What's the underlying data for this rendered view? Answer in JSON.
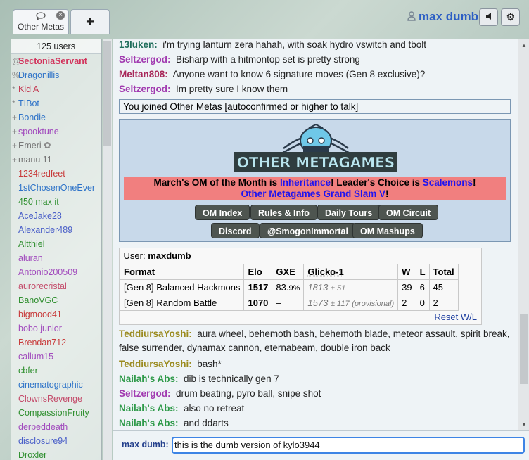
{
  "header": {
    "tab_label": "Other Metas",
    "tab_icon": "speech-bubble-icon",
    "new_tab": "+",
    "username": "max dumb"
  },
  "userlist": {
    "count": "125 users",
    "items": [
      {
        "rank": "@",
        "name": "SectoniaServant",
        "color": "#d2345c",
        "bold": true
      },
      {
        "rank": "%",
        "name": "Dragonillis",
        "color": "#2e73c8"
      },
      {
        "rank": "*",
        "name": "Kid A",
        "color": "#c4364f"
      },
      {
        "rank": "*",
        "name": "TIBot",
        "color": "#2e73c8"
      },
      {
        "rank": "+",
        "name": "Bondie",
        "color": "#2e73c8"
      },
      {
        "rank": "+",
        "name": "spooktune",
        "color": "#a14bbd"
      },
      {
        "rank": "+",
        "name": "Emeri",
        "color": "#777",
        "flower": true
      },
      {
        "rank": "+",
        "name": "manu 11",
        "color": "#777"
      },
      {
        "rank": "",
        "name": "1234redfeet",
        "color": "#c83b3b"
      },
      {
        "rank": "",
        "name": "1stChosenOneEver",
        "color": "#2e73c8"
      },
      {
        "rank": "",
        "name": "450 max it",
        "color": "#2f8f2f"
      },
      {
        "rank": "",
        "name": "AceJake28",
        "color": "#4a5fc8"
      },
      {
        "rank": "",
        "name": "Alexander489",
        "color": "#4a5fc8"
      },
      {
        "rank": "",
        "name": "Altthiel",
        "color": "#2f8f2f"
      },
      {
        "rank": "",
        "name": "aluran",
        "color": "#a14bbd"
      },
      {
        "rank": "",
        "name": "Antonio200509",
        "color": "#a14bbd"
      },
      {
        "rank": "",
        "name": "aurorecristal",
        "color": "#c44b6a"
      },
      {
        "rank": "",
        "name": "BanoVGC",
        "color": "#2f8f2f"
      },
      {
        "rank": "",
        "name": "bigmood41",
        "color": "#c83b3b"
      },
      {
        "rank": "",
        "name": "bobo junior",
        "color": "#a14bbd"
      },
      {
        "rank": "",
        "name": "Brendan712",
        "color": "#c83b3b"
      },
      {
        "rank": "",
        "name": "callum15",
        "color": "#a14bbd"
      },
      {
        "rank": "",
        "name": "cbfer",
        "color": "#2f8f2f"
      },
      {
        "rank": "",
        "name": "cinematographic",
        "color": "#2e73c8"
      },
      {
        "rank": "",
        "name": "ClownsRevenge",
        "color": "#c44b6a"
      },
      {
        "rank": "",
        "name": "CompassionFruity",
        "color": "#2f8f2f"
      },
      {
        "rank": "",
        "name": "derpeddeath",
        "color": "#a14bbd"
      },
      {
        "rank": "",
        "name": "disclosure94",
        "color": "#4a5fc8"
      },
      {
        "rank": "",
        "name": "Droxler",
        "color": "#2f8f2f"
      }
    ]
  },
  "chat_top": [
    {
      "user": "13luken:",
      "color": "#1f6e5c",
      "text": "i'm trying lanturn zera hahah, with soak hydro vswitch and tbolt"
    },
    {
      "user": "Seltzergod:",
      "color": "#a13ab0",
      "text": "Bisharp with a hitmontop set is pretty strong"
    },
    {
      "user": "Meltan808:",
      "color": "#a8285a",
      "text": "Anyone want to know 6 signature moves (Gen 8 exclusive)?"
    },
    {
      "user": "Seltzergod:",
      "color": "#a13ab0",
      "text": "Im pretty sure I know them"
    }
  ],
  "notice": "You joined Other Metas [autoconfirmed or higher to talk]",
  "om_box": {
    "logo_text": "OTHER METAGAMES",
    "line1_a": "March's OM of the Month is ",
    "line1_b": "Inheritance",
    "line1_c": "! Leader's Choice is ",
    "line1_d": "Scalemons",
    "line1_e": "!",
    "line2": "Other Metagames Grand Slam V",
    "line2_end": "!",
    "buttons_row1": [
      "OM Index",
      "Rules & Info",
      "Daily Tours",
      "OM Circuit"
    ],
    "buttons_row2": [
      "Discord",
      "@SmogonImmortal",
      "OM Mashups"
    ]
  },
  "stats": {
    "user_label": "User:",
    "user": "maxdumb",
    "headers": [
      "Format",
      "Elo",
      "GXE",
      "Glicko-1",
      "W",
      "L",
      "Total"
    ],
    "rows": [
      {
        "format": "[Gen 8] Balanced Hackmons",
        "elo": "1517",
        "gxe": "83.",
        "gxe_small": "9%",
        "glicko": "1813",
        "glicko_pm": "± 51",
        "glicko_note": "",
        "w": "39",
        "l": "6",
        "total": "45"
      },
      {
        "format": "[Gen 8] Random Battle",
        "elo": "1070",
        "gxe": "–",
        "gxe_small": "",
        "glicko": "1573",
        "glicko_pm": "± 117",
        "glicko_note": "(provisional)",
        "w": "2",
        "l": "0",
        "total": "2"
      }
    ],
    "reset": "Reset W/L"
  },
  "chat_bottom": [
    {
      "user": "TeddiursaYoshi:",
      "color": "#9a8a1e",
      "text": "aura wheel, behemoth bash, behemoth blade, meteor assault, spirit break, false surrender, dynamax cannon, eternabeam, double iron back"
    },
    {
      "user": "TeddiursaYoshi:",
      "color": "#9a8a1e",
      "text": "bash*"
    },
    {
      "user": "Nailah's Abs:",
      "color": "#2f9a4a",
      "text": "dib is technically gen 7"
    },
    {
      "user": "Seltzergod:",
      "color": "#a13ab0",
      "text": "drum beating, pyro ball, snipe shot"
    },
    {
      "user": "Nailah's Abs:",
      "color": "#2f9a4a",
      "text": "also no retreat"
    },
    {
      "user": "Nailah's Abs:",
      "color": "#2f9a4a",
      "text": "and ddarts"
    }
  ],
  "compose": {
    "name": "max dumb:",
    "value": "this is the dumb version of kylo3944"
  }
}
